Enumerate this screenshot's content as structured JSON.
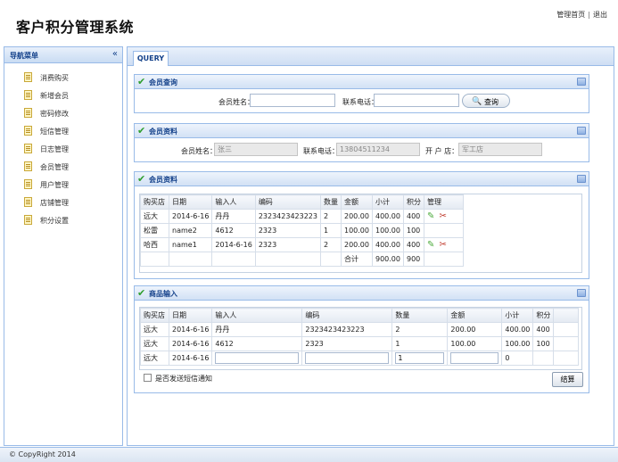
{
  "header": {
    "title": "客户积分管理系统",
    "links": [
      "管理首页",
      "退出"
    ],
    "separator": "|"
  },
  "sidebar": {
    "title": "导航菜单",
    "collapse_glyph": "«",
    "items": [
      "消费购买",
      "新增会员",
      "密码修改",
      "短信管理",
      "日志管理",
      "会员管理",
      "用户管理",
      "店铺管理",
      "积分设置"
    ]
  },
  "tabs": [
    {
      "label": "QUERY"
    }
  ],
  "query_panel": {
    "title": "会员查询",
    "name_label": "会员姓名：",
    "phone_label": "联系电话：",
    "search_label": "查询",
    "name_value": "",
    "phone_value": ""
  },
  "info_panel": {
    "title": "会员资料",
    "name_label": "会员姓名：",
    "name_value": "张三",
    "phone_label": "联系电话：",
    "phone_value": "13804511234",
    "store_label": "开 户 店：",
    "store_value": "军工店"
  },
  "records_panel": {
    "title": "会员资料",
    "columns": [
      "购买店",
      "日期",
      "输入人",
      "编码",
      "数量",
      "金额",
      "小计",
      "积分",
      "管理"
    ],
    "rows": [
      [
        "远大",
        "2014-6-16",
        "丹丹",
        "2323423423223",
        "2",
        "200.00",
        "400.00",
        "400"
      ],
      [
        "松雷",
        "name2",
        "4612",
        "2323",
        "1",
        "100.00",
        "100.00",
        "100"
      ],
      [
        "哈西",
        "name1",
        "2014-6-16",
        "2323",
        "2",
        "200.00",
        "400.00",
        "400"
      ]
    ],
    "row_actions": [
      true,
      false,
      true
    ],
    "total_label": "合计",
    "total_subtotal": "900.00",
    "total_points": "900"
  },
  "entry_panel": {
    "title": "商品输入",
    "columns": [
      "购买店",
      "日期",
      "输入人",
      "编码",
      "数量",
      "金额",
      "小计",
      "积分"
    ],
    "rows": [
      [
        "远大",
        "2014-6-16",
        "丹丹",
        "2323423423223",
        "2",
        "200.00",
        "400.00",
        "400"
      ],
      [
        "远大",
        "2014-6-16",
        "4612",
        "2323",
        "1",
        "100.00",
        "100.00",
        "100"
      ]
    ],
    "input_row": {
      "store": "远大",
      "date": "2014-6-16",
      "quantity": "1",
      "subtotal": "0"
    },
    "sms_label": "是否发送短信通知",
    "settle_label": "结算"
  },
  "footer": {
    "copyright": "© CopyRight 2014"
  },
  "colors": {
    "border": "#99bbe8",
    "title": "#15428b",
    "check": "#2e9e2e",
    "edit": "#4caa3c",
    "delete": "#c0392b"
  },
  "icons": {
    "menu_item": "document-icon",
    "panel": "check-icon",
    "search": "search-icon",
    "edit": "pencil-icon",
    "delete": "cut-icon",
    "panel_tool": "collapse-panel-icon"
  }
}
